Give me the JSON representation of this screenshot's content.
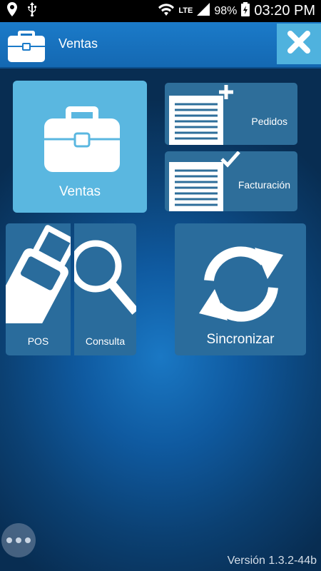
{
  "status_bar": {
    "network_type": "LTE",
    "battery_percent": "98%",
    "time": "03:20 PM",
    "icons": [
      "location-icon",
      "usb-icon",
      "wifi-icon",
      "signal-icon",
      "battery-charging-icon"
    ]
  },
  "header": {
    "title": "Ventas",
    "logo_icon": "briefcase-icon",
    "close_icon": "close-icon"
  },
  "tiles": {
    "ventas": {
      "label": "Ventas",
      "icon": "briefcase-icon"
    },
    "pedidos": {
      "label": "Pedidos",
      "icon": "document-plus-icon"
    },
    "facturacion": {
      "label": "Facturación",
      "icon": "document-check-icon"
    },
    "pos": {
      "label": "POS",
      "icon": "pos-terminal-icon"
    },
    "consulta": {
      "label": "Consulta",
      "icon": "magnifier-icon"
    },
    "sincronizar": {
      "label": "Sincronizar",
      "icon": "sync-icon"
    }
  },
  "footer": {
    "version": "Versión 1.3.2-44b",
    "overflow_icon": "more-icon"
  },
  "colors": {
    "background": "#0f5aa0",
    "header": "#1b7bc9",
    "close_button": "#4fb2de",
    "ventas_tile": "#5ab7e0",
    "tile": "#2a6c9c"
  }
}
